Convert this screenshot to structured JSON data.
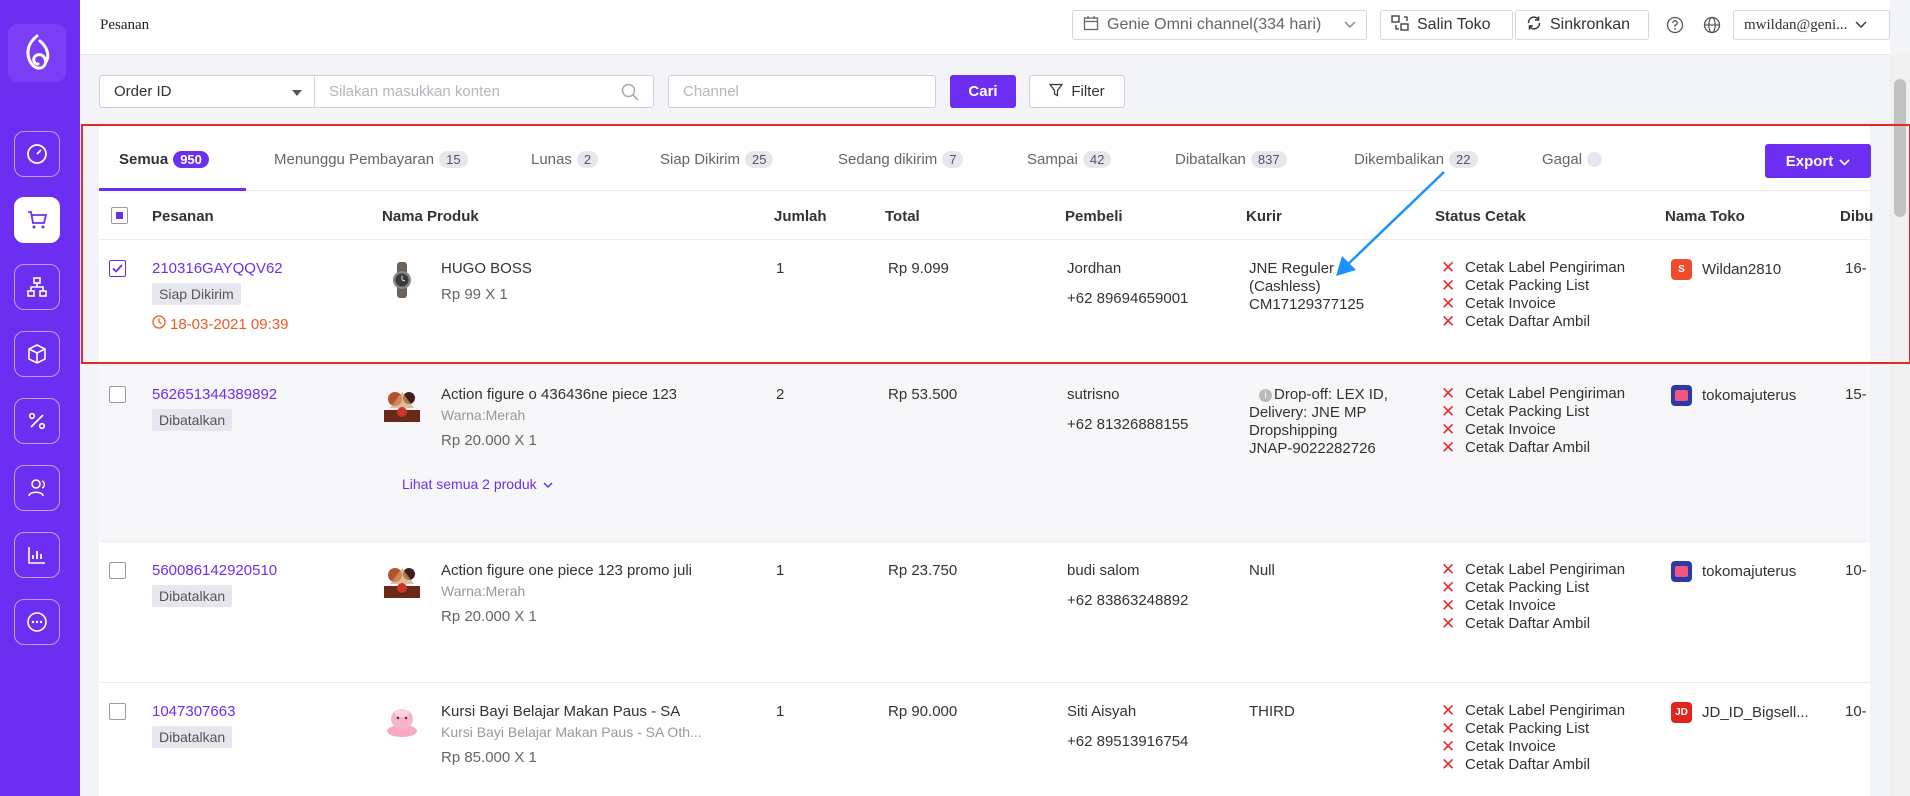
{
  "header": {
    "title": "Pesanan",
    "channel_selector": "Genie Omni channel(334 hari)",
    "copy_store": "Salin Toko",
    "sync": "Sinkronkan",
    "user": "mwildan@geni..."
  },
  "filters": {
    "field_select": "Order ID",
    "search_placeholder": "Silakan masukkan konten",
    "channel_placeholder": "Channel",
    "search_button": "Cari",
    "filter_button": "Filter"
  },
  "tabs": [
    {
      "label": "Semua",
      "count": "950"
    },
    {
      "label": "Menunggu Pembayaran",
      "count": "15"
    },
    {
      "label": "Lunas",
      "count": "2"
    },
    {
      "label": "Siap Dikirim",
      "count": "25"
    },
    {
      "label": "Sedang dikirim",
      "count": "7"
    },
    {
      "label": "Sampai",
      "count": "42"
    },
    {
      "label": "Dibatalkan",
      "count": "837"
    },
    {
      "label": "Dikembalikan",
      "count": "22"
    },
    {
      "label": "Gagal",
      "count": ""
    }
  ],
  "export_label": "Export",
  "columns": [
    "Pesanan",
    "Nama Produk",
    "Jumlah",
    "Total",
    "Pembeli",
    "Kurir",
    "Status Cetak",
    "Nama Toko",
    "Dibu"
  ],
  "print_labels": [
    "Cetak Label Pengiriman",
    "Cetak Packing List",
    "Cetak Invoice",
    "Cetak Daftar Ambil"
  ],
  "orders": [
    {
      "id": "210316GAYQQV62",
      "status": "Siap Dikirim",
      "deadline": "18-03-2021 09:39",
      "product": "HUGO BOSS",
      "variant": "",
      "price_qty": "Rp 99 X 1",
      "qty": "1",
      "total": "Rp 9.099",
      "buyer": "Jordhan",
      "phone": "+62 89694659001",
      "courier": [
        "JNE Reguler",
        "(Cashless)",
        "CM17129377125"
      ],
      "shop": "Wildan2810",
      "date": "16-",
      "checked": true
    },
    {
      "id": "562651344389892",
      "status": "Dibatalkan",
      "deadline": "",
      "product": "Action figure o 436436ne piece 123",
      "variant": "Warna:Merah",
      "price_qty": "Rp 20.000 X 1",
      "see_all": "Lihat semua 2 produk",
      "qty": "2",
      "total": "Rp 53.500",
      "buyer": "sutrisno",
      "phone": "+62 81326888155",
      "courier": [
        "Drop-off: LEX ID,",
        "Delivery: JNE MP",
        "Dropshipping",
        "JNAP-9022282726"
      ],
      "shop": "tokomajuterus",
      "date": "15-",
      "checked": false
    },
    {
      "id": "560086142920510",
      "status": "Dibatalkan",
      "deadline": "",
      "product": "Action figure one piece 123 promo juli",
      "variant": "Warna:Merah",
      "price_qty": "Rp 20.000 X 1",
      "qty": "1",
      "total": "Rp 23.750",
      "buyer": "budi salom",
      "phone": "+62 83863248892",
      "courier": [
        "Null"
      ],
      "shop": "tokomajuterus",
      "date": "10-",
      "checked": false
    },
    {
      "id": "1047307663",
      "status": "Dibatalkan",
      "deadline": "",
      "product": "Kursi Bayi Belajar Makan Paus - SA",
      "variant": "Kursi Bayi Belajar Makan Paus - SA Oth...",
      "price_qty": "Rp 85.000 X 1",
      "qty": "1",
      "total": "Rp 90.000",
      "buyer": "Siti Aisyah",
      "phone": "+62 89513916754",
      "courier": [
        "THIRD"
      ],
      "shop": "JD_ID_Bigsell...",
      "date": "10-",
      "checked": false
    }
  ],
  "colors": {
    "accent": "#6c2ff2",
    "highlight": "#e82727",
    "arrow": "#1e90ff",
    "error": "#e03131"
  }
}
